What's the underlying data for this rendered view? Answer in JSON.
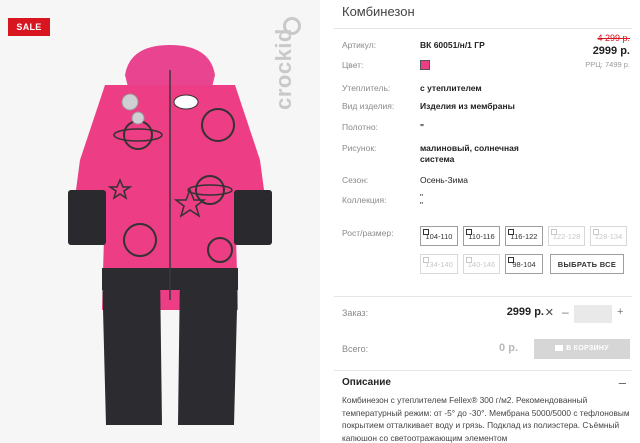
{
  "sale_badge": "SALE",
  "brand": "crockid",
  "product": {
    "title": "Комбинезон",
    "old_price": "4 299 р.",
    "price": "2999 р.",
    "rrp": "РРЦ: 7499 р.",
    "swatch_color": "#ec3d85"
  },
  "attributes": [
    {
      "label": "Артикул:",
      "value": "ВК 60051/н/1 ГР"
    },
    {
      "label": "Цвет:",
      "value": ""
    },
    {
      "label": "Утеплитель:",
      "value": "с утеплителем"
    },
    {
      "label": "Вид изделия:",
      "value": "Изделия из мембраны"
    },
    {
      "label": "Полотно:",
      "value": "\""
    },
    {
      "label": "Рисунок:",
      "value": "малиновый, солнечная система"
    },
    {
      "label": "Сезон:",
      "value": "Осень-Зима"
    },
    {
      "label": "Коллекция:",
      "value": "\"\n\""
    },
    {
      "label": "Рост/размер:",
      "value": ""
    }
  ],
  "sizes": [
    {
      "label": "104-110",
      "available": true
    },
    {
      "label": "110-116",
      "available": true
    },
    {
      "label": "116-122",
      "available": true
    },
    {
      "label": "122-128",
      "available": false
    },
    {
      "label": "128-134",
      "available": false
    },
    {
      "label": "134-140",
      "available": false
    },
    {
      "label": "140-146",
      "available": false
    },
    {
      "label": "98-104",
      "available": true
    }
  ],
  "select_all": "ВЫБРАТЬ ВСЕ",
  "order": {
    "label": "Заказ:",
    "price": "2999 р.",
    "times": "✕",
    "minus": "–",
    "plus": "+",
    "qty": ""
  },
  "total": {
    "label": "Всего:",
    "value": "0 р.",
    "cart_button": "В КОРЗИНУ"
  },
  "description": {
    "heading": "Описание",
    "toggle": "–",
    "text": "Комбинезон с утеплителем Fellex® 300 г/м2. Рекомендованный температурный режим: от -5° до -30°. Мембрана 5000/5000 с тефлоновым покрытием отталкивает воду и грязь. Подклад из полиэстера. Съёмный капюшон со светоотражающим элементом"
  }
}
